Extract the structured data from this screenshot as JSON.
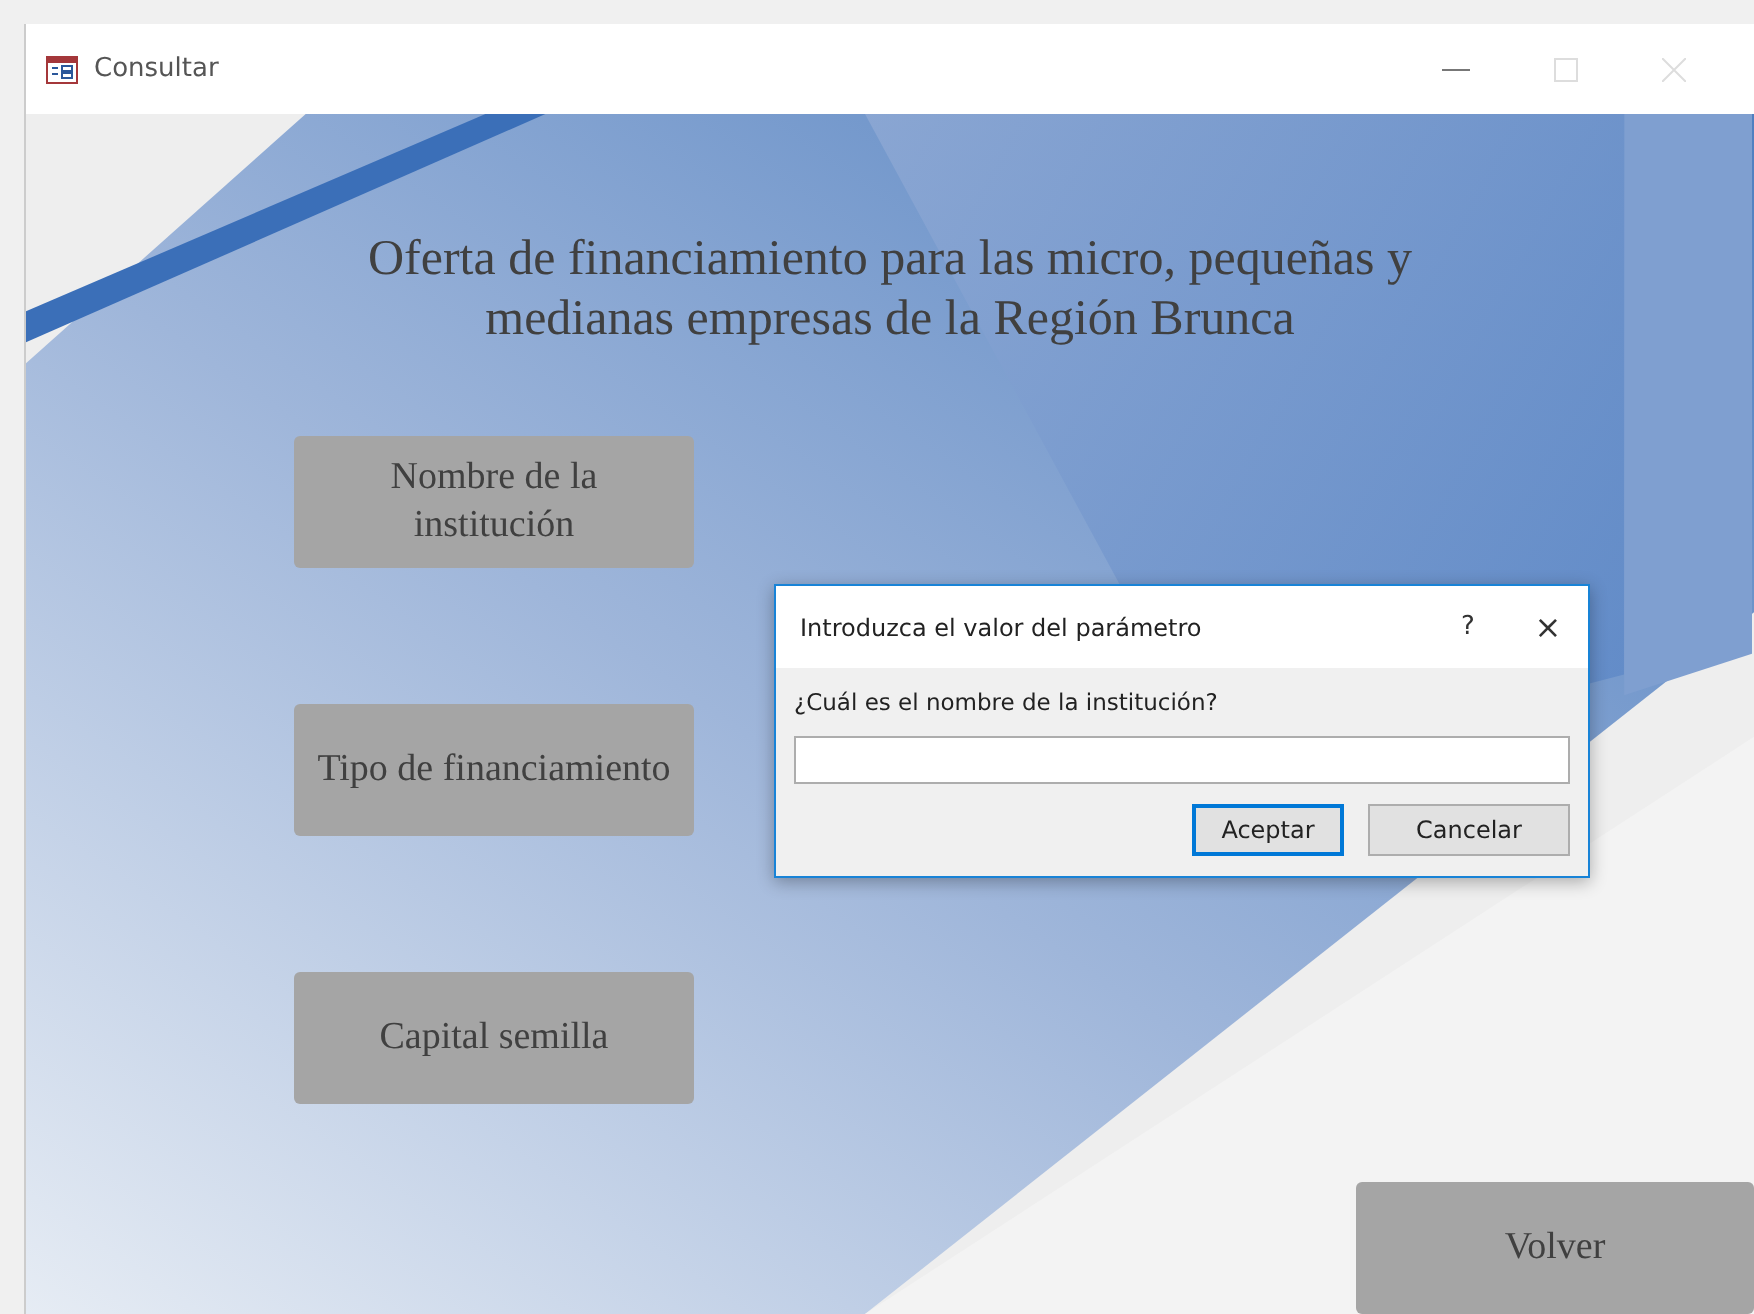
{
  "window": {
    "title": "Consultar"
  },
  "form": {
    "heading": "Oferta de financiamiento para las micro, pequeñas y medianas empresas de la Región Brunca",
    "buttons": [
      {
        "label": "Nombre de la institución"
      },
      {
        "label": "Tipo de financiamiento"
      },
      {
        "label": "Capital semilla"
      }
    ],
    "back_button": "Volver"
  },
  "dialog": {
    "title": "Introduzca el valor del parámetro",
    "help": "?",
    "close": "×",
    "prompt": "¿Cuál es el nombre de la institución?",
    "buttons": [
      {
        "label": "Aceptar",
        "selected": true
      },
      {
        "label": "Cancelar",
        "selected": false
      }
    ]
  }
}
